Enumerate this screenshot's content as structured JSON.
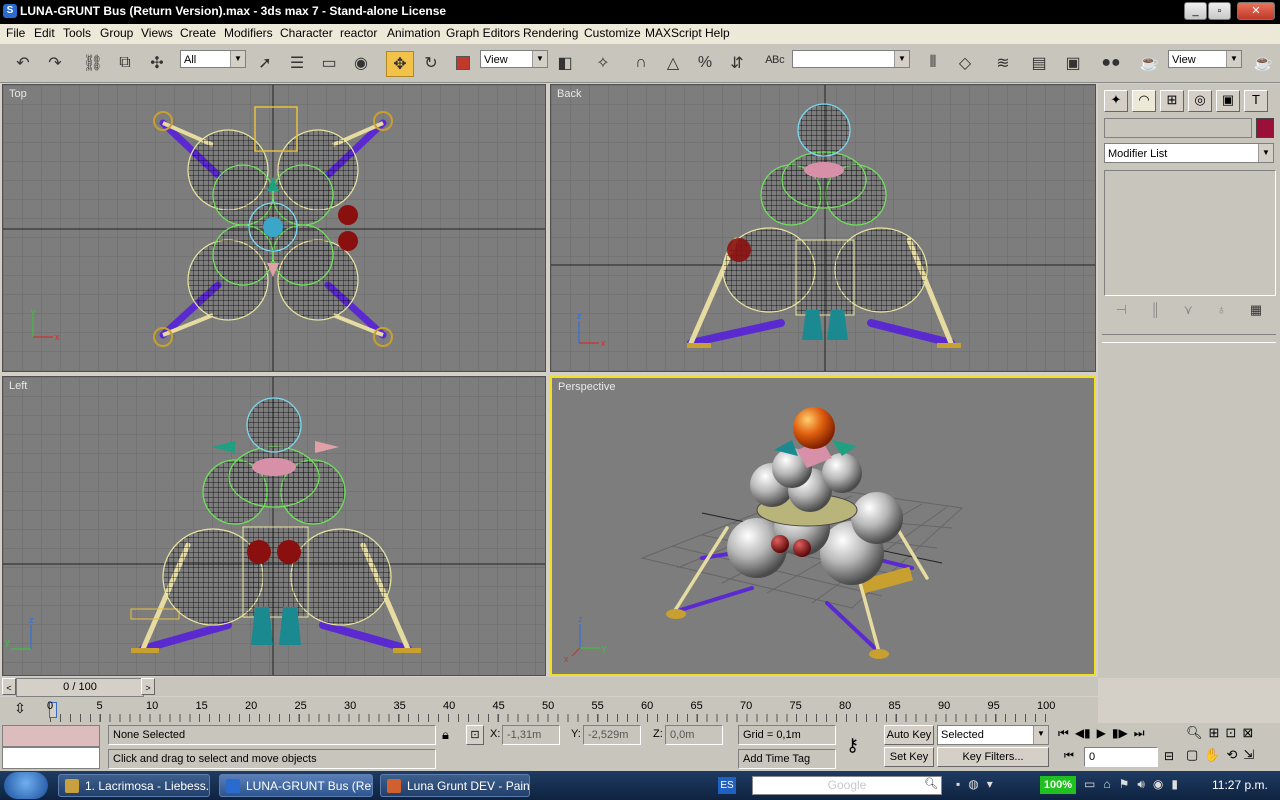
{
  "window": {
    "title": "LUNA-GRUNT Bus (Return Version).max - 3ds max 7  - Stand-alone License",
    "app_icon": "3ds-max-icon"
  },
  "menu": [
    "File",
    "Edit",
    "Tools",
    "Group",
    "Views",
    "Create",
    "Modifiers",
    "Character",
    "reactor",
    "Animation",
    "Graph Editors",
    "Rendering",
    "Customize",
    "MAXScript",
    "Help"
  ],
  "toolbar": {
    "selection_filter": "All",
    "ref_coord": "View",
    "named_selection": "",
    "view_right": "View"
  },
  "viewports": {
    "top": "Top",
    "back": "Back",
    "left": "Left",
    "perspective": "Perspective"
  },
  "axis_labels": {
    "x": "x",
    "y": "y",
    "z": "z"
  },
  "command_panel": {
    "name_field": "",
    "color_swatch": "#9b1038",
    "modifier_list": "Modifier List"
  },
  "timeline": {
    "frame_label": "0 / 100",
    "ticks": [
      "0",
      "5",
      "10",
      "15",
      "20",
      "25",
      "30",
      "35",
      "40",
      "45",
      "50",
      "55",
      "60",
      "65",
      "70",
      "75",
      "80",
      "85",
      "90",
      "95",
      "100"
    ]
  },
  "status": {
    "selection": "None Selected",
    "prompt": "Click and drag to select and move objects",
    "x_label": "X:",
    "x_value": "-1,31m",
    "y_label": "Y:",
    "y_value": "-2,529m",
    "z_label": "Z:",
    "z_value": "0,0m",
    "grid": "Grid = 0,1m",
    "add_time_tag": "Add Time Tag",
    "auto_key": "Auto Key",
    "set_key": "Set Key",
    "key_mode": "Selected",
    "key_filters": "Key Filters...",
    "current_frame": "0"
  },
  "taskbar": {
    "tasks": [
      "1. Lacrimosa - Liebess...",
      "LUNA-GRUNT Bus (Ret...",
      "Luna Grunt DEV - Paint"
    ],
    "language": "ES",
    "search_placeholder": "Google",
    "battery": "100%",
    "clock": "11:27 p.m."
  },
  "colors": {
    "viewport_bg": "#7d7d7d",
    "active_border": "#f0e020",
    "accent_yellow": "#f3c24a",
    "wire_yellow": "#e8e6a0",
    "wire_green": "#6fe05a",
    "wire_cyan": "#7ad8f0",
    "strut_purple": "#5a2ad0"
  }
}
